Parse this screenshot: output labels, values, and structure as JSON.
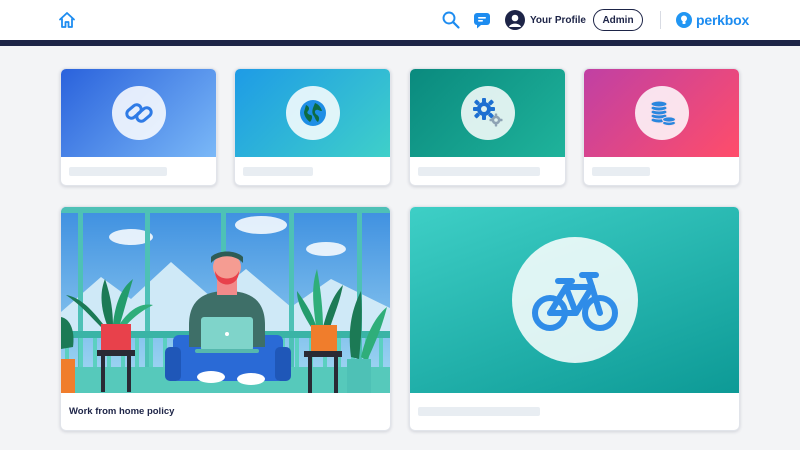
{
  "header": {
    "home_icon": "home-icon",
    "search_icon": "search-icon",
    "messages_icon": "chat-icon",
    "profile_label": "Your Profile",
    "admin_label": "Admin",
    "logo_text": "perkbox",
    "colors": {
      "navy": "#1d2447",
      "brand_blue": "#1d8cf0"
    }
  },
  "cards": [
    {
      "icon": "link-icon",
      "gradient": [
        "#2a62dc",
        "#7ab8f7"
      ]
    },
    {
      "icon": "globe-icon",
      "gradient": [
        "#1e9be6",
        "#3fd0c9"
      ]
    },
    {
      "icon": "gears-icon",
      "gradient": [
        "#0a8a7e",
        "#1fb39b"
      ]
    },
    {
      "icon": "coins-icon",
      "gradient": [
        "#c040a4",
        "#ff4d6a"
      ]
    }
  ],
  "feature_cards": [
    {
      "title": "Work from home policy",
      "image": "man-working-on-laptop-illustration"
    },
    {
      "icon": "bicycle-icon",
      "gradient": [
        "#3ecfc6",
        "#0d9a96"
      ]
    }
  ]
}
